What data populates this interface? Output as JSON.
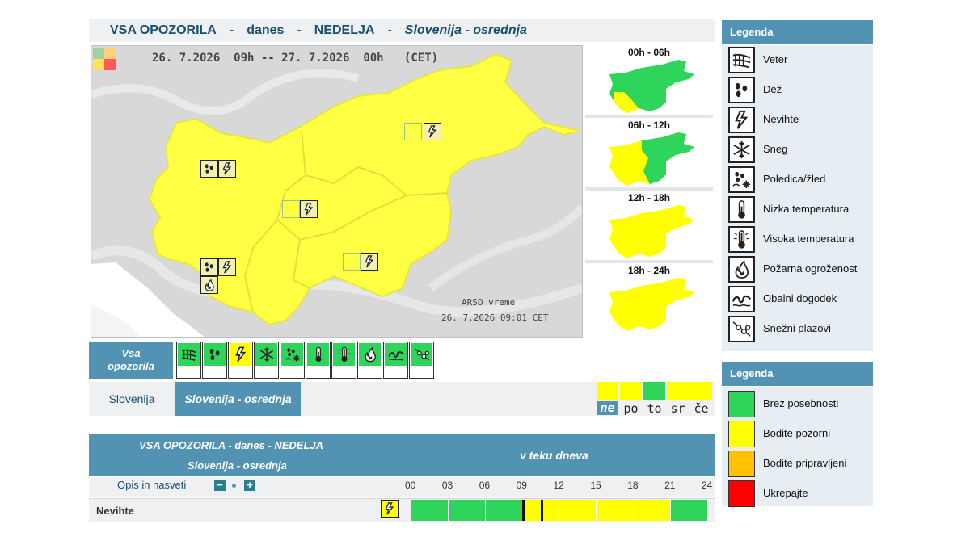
{
  "header": {
    "part1": "VSA OPOZORILA",
    "sep": "-",
    "part2": "danes",
    "part3": "NEDELJA",
    "part4": "Slovenija - osrednja"
  },
  "map": {
    "date_from": "26. 7.2026  09h",
    "dash": "--",
    "date_to": "27. 7.2026  00h",
    "zone": "(CET)",
    "source": "ARSO vreme",
    "stamp": "26. 7.2026  09:01 CET"
  },
  "time_maps": [
    {
      "label": "00h - 06h"
    },
    {
      "label": "06h - 12h"
    },
    {
      "label": "12h - 18h"
    },
    {
      "label": "18h - 24h"
    }
  ],
  "legend_icons": {
    "title": "Legenda",
    "items": [
      {
        "label": "Veter",
        "icon": "wind-icon"
      },
      {
        "label": "Dež",
        "icon": "rain-icon"
      },
      {
        "label": "Nevihte",
        "icon": "thunderstorm-icon"
      },
      {
        "label": "Sneg",
        "icon": "snow-icon"
      },
      {
        "label": "Poledica/žled",
        "icon": "ice-icon"
      },
      {
        "label": "Nizka temperatura",
        "icon": "low-temperature-icon"
      },
      {
        "label": "Visoka temperatura",
        "icon": "high-temperature-icon"
      },
      {
        "label": "Požarna ogroženost",
        "icon": "fire-danger-icon"
      },
      {
        "label": "Obalni dogodek",
        "icon": "coastal-event-icon"
      },
      {
        "label": "Snežni plazovi",
        "icon": "avalanche-icon"
      }
    ]
  },
  "legend_colors": {
    "title": "Legenda",
    "items": [
      {
        "label": "Brez posebnosti",
        "color": "#2fd45a"
      },
      {
        "label": "Bodite pozorni",
        "color": "#ffff00"
      },
      {
        "label": "Bodite pripravljeni",
        "color": "#ffc000"
      },
      {
        "label": "Ukrepajte",
        "color": "#ff0000"
      }
    ]
  },
  "type_bar": {
    "all_label_1": "Vsa",
    "all_label_2": "opozorila",
    "types": [
      {
        "icon": "wind-icon",
        "color": "#2fd45a"
      },
      {
        "icon": "rain-icon",
        "color": "#2fd45a"
      },
      {
        "icon": "thunderstorm-icon",
        "color": "#ffff00"
      },
      {
        "icon": "snow-icon",
        "color": "#2fd45a"
      },
      {
        "icon": "ice-icon",
        "color": "#2fd45a"
      },
      {
        "icon": "low-temperature-icon",
        "color": "#2fd45a"
      },
      {
        "icon": "high-temperature-icon",
        "color": "#2fd45a"
      },
      {
        "icon": "fire-danger-icon",
        "color": "#2fd45a"
      },
      {
        "icon": "coastal-event-icon",
        "color": "#2fd45a"
      },
      {
        "icon": "avalanche-icon",
        "color": "#2fd45a"
      }
    ]
  },
  "regions": {
    "country": "Slovenija",
    "selected": "Slovenija - osrednja"
  },
  "days": [
    {
      "label": "ne",
      "color": "#ffff00",
      "selected": true
    },
    {
      "label": "po",
      "color": "#ffff00",
      "selected": false
    },
    {
      "label": "to",
      "color": "#2fd45a",
      "selected": false
    },
    {
      "label": "sr",
      "color": "#ffff00",
      "selected": false
    },
    {
      "label": "če",
      "color": "#ffff00",
      "selected": false
    }
  ],
  "timeline": {
    "title1": "VSA OPOZORILA - danes - NEDELJA",
    "title2": "Slovenija - osrednja",
    "title3": "v teku dneva",
    "opis": "Opis in nasveti",
    "minus": "−",
    "plus": "+",
    "ticks": [
      "00",
      "03",
      "06",
      "09",
      "12",
      "15",
      "18",
      "21",
      "24"
    ],
    "row_label": "Nevihte",
    "row_icon": "thunderstorm-icon",
    "segments": [
      {
        "from": 0,
        "to": 3,
        "color": "#2fd45a"
      },
      {
        "from": 3,
        "to": 6,
        "color": "#2fd45a"
      },
      {
        "from": 6,
        "to": 9,
        "color": "#2fd45a"
      },
      {
        "from": 9,
        "to": 12,
        "color": "#ffff00"
      },
      {
        "from": 12,
        "to": 15,
        "color": "#ffff00"
      },
      {
        "from": 15,
        "to": 18,
        "color": "#ffff00"
      },
      {
        "from": 18,
        "to": 21,
        "color": "#ffff00"
      },
      {
        "from": 21,
        "to": 24,
        "color": "#2fd45a"
      }
    ],
    "markers_hours": [
      9,
      10.5
    ]
  }
}
